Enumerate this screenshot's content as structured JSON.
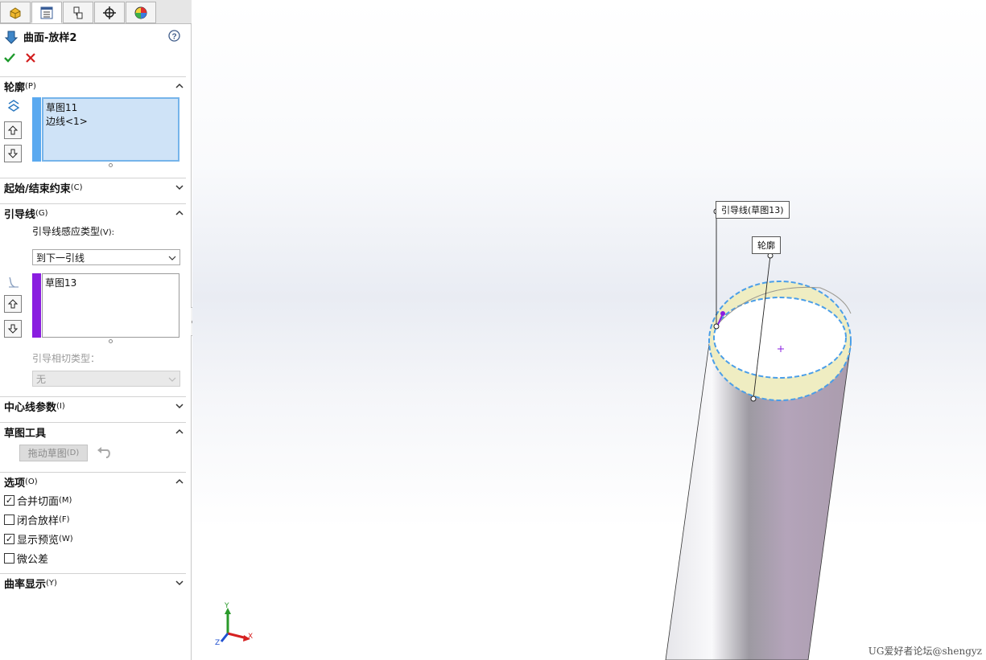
{
  "tabs": [
    {
      "icon": "feature-manager-icon"
    },
    {
      "icon": "property-manager-icon",
      "active": true
    },
    {
      "icon": "configuration-manager-icon"
    },
    {
      "icon": "dimxpert-icon"
    },
    {
      "icon": "display-manager-icon"
    }
  ],
  "feature": {
    "title": "曲面-放样2",
    "help_icon": "help-icon",
    "ok_icon": "checkmark-icon",
    "cancel_icon": "close-icon"
  },
  "profile_section": {
    "title": "轮廓",
    "hotkey": "(P)",
    "items": [
      "草图11",
      "边线<1>"
    ],
    "bar_color": "#5aa9f0"
  },
  "constraints_section": {
    "title": "起始/结束约束",
    "hotkey": "(C)"
  },
  "guides_section": {
    "title": "引导线",
    "hotkey": "(G)",
    "influence_label": "引导线感应类型",
    "influence_hotkey": "(V):",
    "influence_value": "到下一引线",
    "items": [
      "草图13"
    ],
    "bar_color": "#8a1de0",
    "tangency_label": "引导相切类型：",
    "tangency_value": "无"
  },
  "centerline_section": {
    "title": "中心线参数",
    "hotkey": "(I)"
  },
  "sketch_tools_section": {
    "title": "草图工具",
    "drag_button": "拖动草图",
    "drag_hotkey": "(D)"
  },
  "options_section": {
    "title": "选项",
    "hotkey": "(O)",
    "options": [
      {
        "label": "合并切面",
        "hotkey": "(M)",
        "checked": true
      },
      {
        "label": "闭合放样",
        "hotkey": "(F)",
        "checked": false
      },
      {
        "label": "显示预览",
        "hotkey": "(W)",
        "checked": true
      },
      {
        "label": "微公差",
        "hotkey": "",
        "checked": false
      }
    ]
  },
  "curvature_section": {
    "title": "曲率显示",
    "hotkey": "(Y)"
  },
  "viewport": {
    "guide_callout": "引导线(草图13)",
    "profile_callout": "轮廓",
    "axis_labels": {
      "x": "X",
      "y": "Y",
      "z": "Z"
    },
    "colors": {
      "axis_x": "#d62020",
      "axis_y": "#2a9a2a",
      "axis_z": "#2050d0",
      "preview": "#efedc2"
    }
  },
  "watermark": "UG爱好者论坛@shengyz"
}
